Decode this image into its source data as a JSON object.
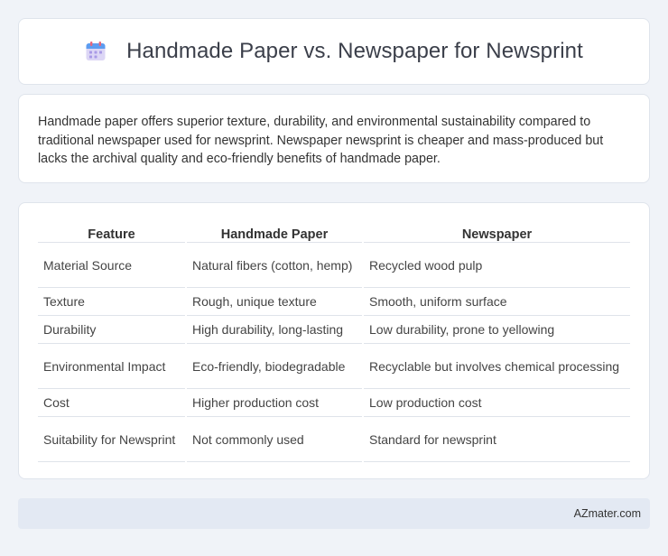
{
  "header": {
    "title": "Handmade Paper vs. Newspaper for Newsprint",
    "icon": "calendar-icon"
  },
  "summary": {
    "text": "Handmade paper offers superior texture, durability, and environmental sustainability compared to traditional newspaper used for newsprint. Newspaper newsprint is cheaper and mass-produced but lacks the archival quality and eco-friendly benefits of handmade paper."
  },
  "table": {
    "headers": [
      "Feature",
      "Handmade Paper",
      "Newspaper"
    ],
    "rows": [
      [
        "Material Source",
        "Natural fibers (cotton, hemp)",
        "Recycled wood pulp"
      ],
      [
        "Texture",
        "Rough, unique texture",
        "Smooth, uniform surface"
      ],
      [
        "Durability",
        "High durability, long-lasting",
        "Low durability, prone to yellowing"
      ],
      [
        "Environmental Impact",
        "Eco-friendly, biodegradable",
        "Recyclable but involves chemical processing"
      ],
      [
        "Cost",
        "Higher production cost",
        "Low production cost"
      ],
      [
        "Suitability for Newsprint",
        "Not commonly used",
        "Standard for newsprint"
      ]
    ]
  },
  "footer": {
    "text": "AZmater.com"
  }
}
